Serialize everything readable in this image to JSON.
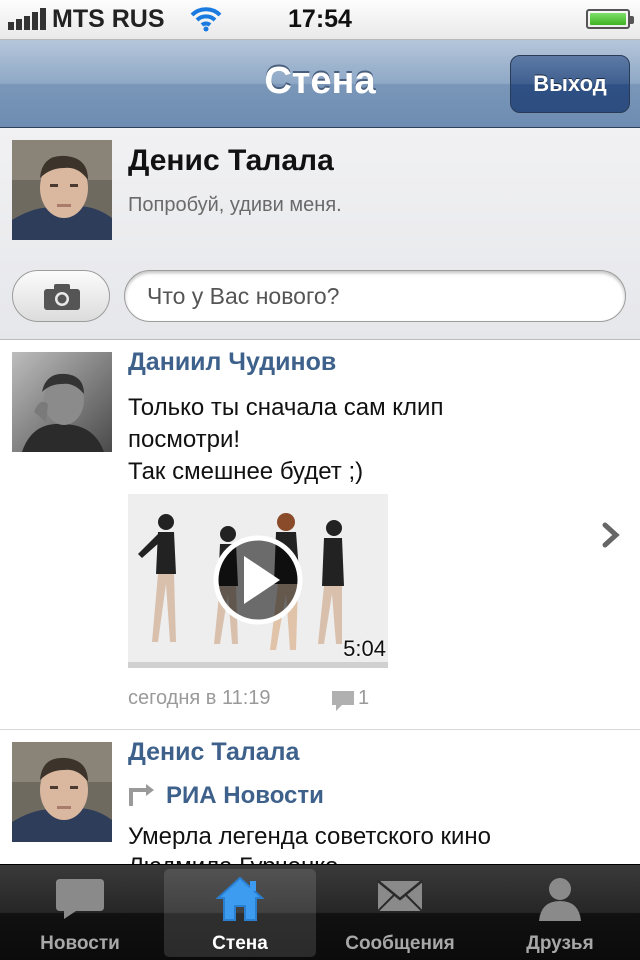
{
  "status_bar": {
    "carrier": "MTS RUS",
    "time": "17:54",
    "battery_level": 1.0
  },
  "navbar": {
    "title": "Стена",
    "logout_label": "Выход"
  },
  "profile": {
    "name": "Денис Талала",
    "status": "Попробуй, удиви меня.",
    "post_placeholder": "Что у Вас нового?"
  },
  "feed": {
    "posts": [
      {
        "author": "Даниил Чудинов",
        "text": "Только ты сначала сам клип\nпосмотри!\nТак смешнее будет ;)",
        "video_duration": "5:04",
        "date": "сегодня в 11:19",
        "comments": "1"
      },
      {
        "author": "Денис Талала",
        "repost_source": "РИА Новости",
        "text": "Умерла легенда советского кино",
        "text_line2": "Людмила Гурченко"
      }
    ]
  },
  "tabbar": {
    "tabs": [
      {
        "label": "Новости",
        "icon": "speech-bubble-icon"
      },
      {
        "label": "Стена",
        "icon": "home-icon",
        "active": true
      },
      {
        "label": "Сообщения",
        "icon": "envelope-icon"
      },
      {
        "label": "Друзья",
        "icon": "person-icon"
      }
    ]
  },
  "colors": {
    "accent_link": "#3e618b",
    "navbar": "#7a97b9",
    "tabbar": "#1a1a1a"
  }
}
